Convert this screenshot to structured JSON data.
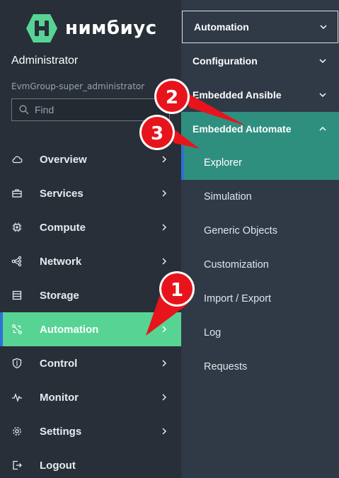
{
  "brand": {
    "name": "нимбиус",
    "color": "#57d494"
  },
  "user": {
    "name": "Administrator",
    "group": "EvmGroup-super_administrator"
  },
  "search": {
    "placeholder": "Find",
    "value": ""
  },
  "nav": {
    "items": [
      {
        "label": "Overview",
        "icon": "cloud-icon"
      },
      {
        "label": "Services",
        "icon": "briefcase-icon"
      },
      {
        "label": "Compute",
        "icon": "chip-icon"
      },
      {
        "label": "Network",
        "icon": "network-icon"
      },
      {
        "label": "Storage",
        "icon": "database-icon"
      },
      {
        "label": "Automation",
        "icon": "automation-icon",
        "active": true
      },
      {
        "label": "Control",
        "icon": "shield-icon"
      },
      {
        "label": "Monitor",
        "icon": "pulse-icon"
      },
      {
        "label": "Settings",
        "icon": "gear-icon"
      },
      {
        "label": "Logout",
        "icon": "logout-icon"
      }
    ]
  },
  "flyout": {
    "sections": [
      {
        "label": "Automation",
        "state": "collapsed"
      },
      {
        "label": "Configuration",
        "state": "collapsed"
      },
      {
        "label": "Embedded Ansible",
        "state": "collapsed"
      },
      {
        "label": "Embedded Automate",
        "state": "expanded"
      }
    ],
    "subitems": [
      {
        "label": "Explorer",
        "active": true
      },
      {
        "label": "Simulation"
      },
      {
        "label": "Generic Objects"
      },
      {
        "label": "Customization"
      },
      {
        "label": "Import / Export"
      },
      {
        "label": "Log"
      },
      {
        "label": "Requests"
      }
    ]
  },
  "annotations": [
    "1",
    "2",
    "3"
  ],
  "colors": {
    "active_green": "#57d494",
    "teal": "#2f8f7f",
    "accent_blue": "#2f6fd6",
    "marker_red": "#e8141c"
  }
}
